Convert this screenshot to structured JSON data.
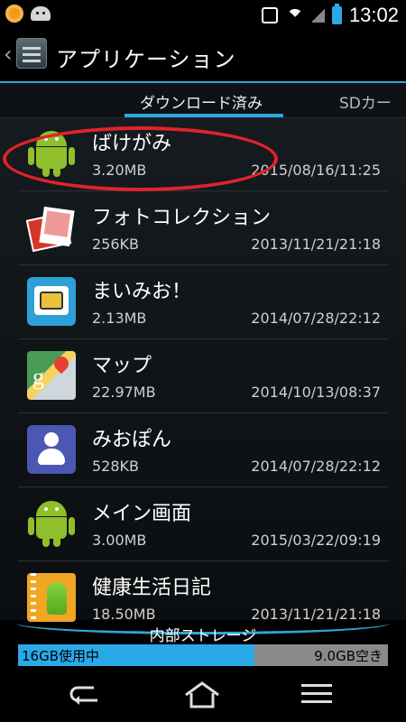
{
  "status_bar": {
    "time": "13:02",
    "left_icons": [
      "notification-circle-icon",
      "android-debug-icon"
    ],
    "right_icons": [
      "screen-lock-icon",
      "wifi-icon",
      "signal-icon",
      "battery-icon"
    ]
  },
  "app_bar": {
    "title": "アプリケーション"
  },
  "tabs": {
    "active": "ダウンロード済み",
    "next": "SDカード"
  },
  "apps": [
    {
      "name": "ばけがみ",
      "size": "3.20MB",
      "date": "2015/08/16/11:25",
      "icon": "android-icon"
    },
    {
      "name": "フォトコレクション",
      "size": "256KB",
      "date": "2013/11/21/21:18",
      "icon": "photo-collection-icon"
    },
    {
      "name": "まいみお！",
      "size": "2.13MB",
      "date": "2014/07/28/22:12",
      "icon": "sim-card-icon"
    },
    {
      "name": "マップ",
      "size": "22.97MB",
      "date": "2014/10/13/08:37",
      "icon": "maps-icon"
    },
    {
      "name": "みおぽん",
      "size": "528KB",
      "date": "2014/07/28/22:12",
      "icon": "miopon-icon"
    },
    {
      "name": "メイン画面",
      "size": "3.00MB",
      "date": "2015/03/22/09:19",
      "icon": "android-icon"
    },
    {
      "name": "健康生活日記",
      "size": "18.50MB",
      "date": "2013/11/21/21:18",
      "icon": "health-diary-icon"
    }
  ],
  "storage": {
    "label": "内部ストレージ",
    "used_text": "16GB使用中",
    "free_text": "9.0GB空き",
    "used_fraction": 0.64
  },
  "colors": {
    "accent": "#2fa5d9",
    "highlight_ellipse": "#e0232c"
  }
}
